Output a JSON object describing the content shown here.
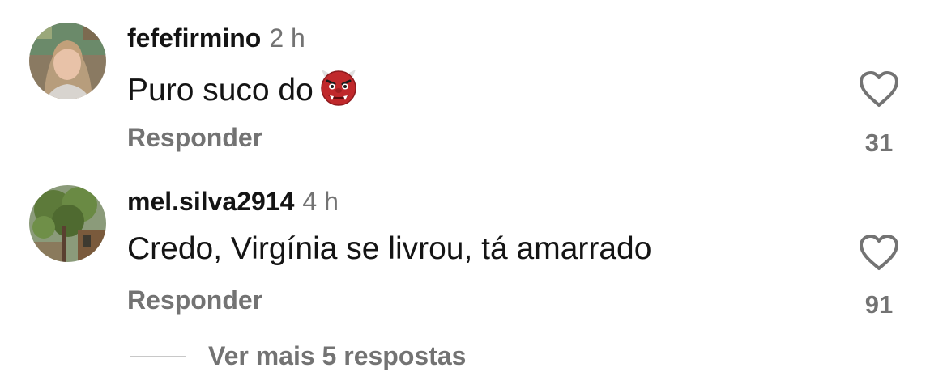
{
  "comments": [
    {
      "username": "fefefirmino",
      "time": "2 h",
      "text": "Puro suco do",
      "emoji": "ogre-emoji",
      "reply_label": "Responder",
      "like_count": "31",
      "like_icon": "heart-outline-icon"
    },
    {
      "username": "mel.silva2914",
      "time": "4 h",
      "text": "Credo, Virgínia se livrou, tá amarrado",
      "reply_label": "Responder",
      "like_count": "91",
      "like_icon": "heart-outline-icon"
    }
  ],
  "more_replies": "Ver mais 5 respostas",
  "colors": {
    "primary_text": "#141414",
    "secondary_text": "#737373",
    "divider": "#c8c8c8",
    "background": "#ffffff"
  }
}
